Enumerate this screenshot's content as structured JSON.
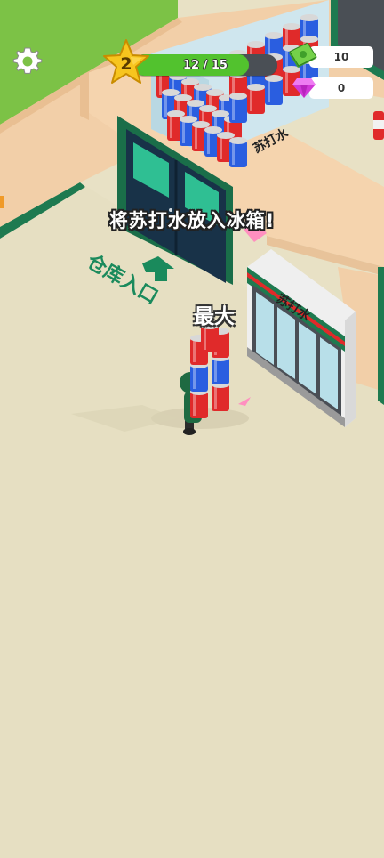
{
  "hud": {
    "level": "2",
    "xp_text": "12 / 15",
    "xp_fraction": 0.8,
    "cash": "10",
    "gems": "0",
    "settings_icon": "gear-icon",
    "cash_icon": "cash-icon",
    "gem_icon": "gem-icon"
  },
  "instruction": "将苏打水放入冰箱!",
  "scene": {
    "warehouse_floor_label": "仓库入口",
    "fridge_sign": "苏打水",
    "shelf_sign": "苏打水",
    "stack_label": "最大"
  },
  "colors": {
    "floor": "#e8e1c5",
    "wall": "#f5d4ae",
    "grass": "#7cc246",
    "accent_green": "#1e8a5c",
    "xp_green": "#52c22e",
    "can_red": "#e02a2a",
    "can_blue": "#2a5ee0"
  }
}
